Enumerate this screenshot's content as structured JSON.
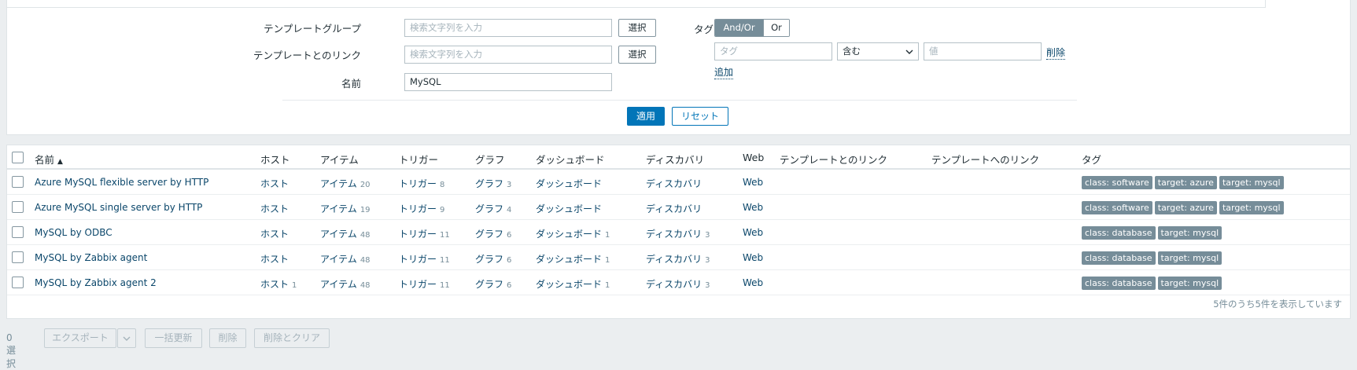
{
  "filter": {
    "template_group_label": "テンプレートグループ",
    "template_link_label": "テンプレートとのリンク",
    "name_label": "名前",
    "search_placeholder": "検索文字列を入力",
    "select_label": "選択",
    "name_value": "MySQL",
    "tags_label": "タグ",
    "and_or_label": "And/Or",
    "or_label": "Or",
    "tag_placeholder": "タグ",
    "operator_value": "含む",
    "value_placeholder": "値",
    "remove_label": "削除",
    "add_label": "追加",
    "apply_label": "適用",
    "reset_label": "リセット"
  },
  "table": {
    "columns": {
      "name": "名前",
      "sort_indicator": "▲",
      "hosts": "ホスト",
      "items": "アイテム",
      "triggers": "トリガー",
      "graphs": "グラフ",
      "dashboards": "ダッシュボード",
      "discovery": "ディスカバリ",
      "web": "Web",
      "linked_templates": "テンプレートとのリンク",
      "linked_to_templates": "テンプレートへのリンク",
      "tags": "タグ"
    },
    "rows": [
      {
        "name": "Azure MySQL flexible server by HTTP",
        "hosts": "ホスト",
        "hosts_count": "",
        "items": "アイテム",
        "items_count": "20",
        "triggers": "トリガー",
        "triggers_count": "8",
        "graphs": "グラフ",
        "graphs_count": "3",
        "dashboards": "ダッシュボード",
        "dashboards_count": "",
        "discovery": "ディスカバリ",
        "discovery_count": "",
        "web": "Web",
        "tags": [
          "class: software",
          "target: azure",
          "target: mysql"
        ]
      },
      {
        "name": "Azure MySQL single server by HTTP",
        "hosts": "ホスト",
        "hosts_count": "",
        "items": "アイテム",
        "items_count": "19",
        "triggers": "トリガー",
        "triggers_count": "9",
        "graphs": "グラフ",
        "graphs_count": "4",
        "dashboards": "ダッシュボード",
        "dashboards_count": "",
        "discovery": "ディスカバリ",
        "discovery_count": "",
        "web": "Web",
        "tags": [
          "class: software",
          "target: azure",
          "target: mysql"
        ]
      },
      {
        "name": "MySQL by ODBC",
        "hosts": "ホスト",
        "hosts_count": "",
        "items": "アイテム",
        "items_count": "48",
        "triggers": "トリガー",
        "triggers_count": "11",
        "graphs": "グラフ",
        "graphs_count": "6",
        "dashboards": "ダッシュボード",
        "dashboards_count": "1",
        "discovery": "ディスカバリ",
        "discovery_count": "3",
        "web": "Web",
        "tags": [
          "class: database",
          "target: mysql"
        ]
      },
      {
        "name": "MySQL by Zabbix agent",
        "hosts": "ホスト",
        "hosts_count": "",
        "items": "アイテム",
        "items_count": "48",
        "triggers": "トリガー",
        "triggers_count": "11",
        "graphs": "グラフ",
        "graphs_count": "6",
        "dashboards": "ダッシュボード",
        "dashboards_count": "1",
        "discovery": "ディスカバリ",
        "discovery_count": "3",
        "web": "Web",
        "tags": [
          "class: database",
          "target: mysql"
        ]
      },
      {
        "name": "MySQL by Zabbix agent 2",
        "hosts": "ホスト",
        "hosts_count": "1",
        "items": "アイテム",
        "items_count": "48",
        "triggers": "トリガー",
        "triggers_count": "11",
        "graphs": "グラフ",
        "graphs_count": "6",
        "dashboards": "ダッシュボード",
        "dashboards_count": "1",
        "discovery": "ディスカバリ",
        "discovery_count": "3",
        "web": "Web",
        "tags": [
          "class: database",
          "target: mysql"
        ]
      }
    ],
    "footer": "5件のうち5件を表示しています"
  },
  "actions": {
    "selected": "0 選択",
    "export": "エクスポート",
    "mass_update": "一括更新",
    "delete": "削除",
    "delete_clear": "削除とクリア"
  },
  "colors": {
    "link": "#0a466a",
    "primary_button": "#0275b8",
    "tag_bg": "#768d99",
    "page_bg": "#ebeef0"
  }
}
